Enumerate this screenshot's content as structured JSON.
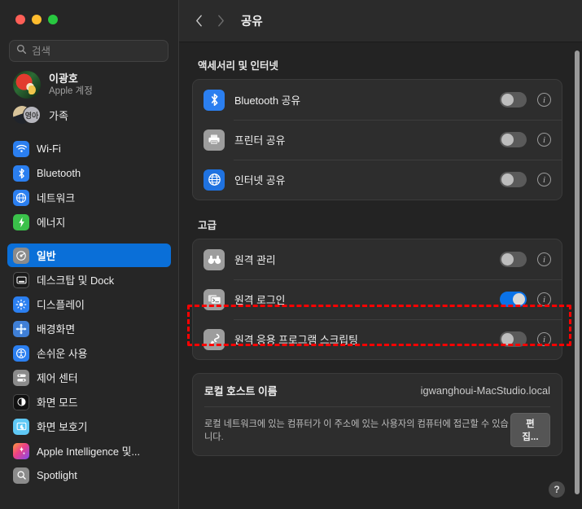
{
  "window": {
    "traffic_lights": [
      "close",
      "minimize",
      "zoom"
    ],
    "colors": {
      "accent_blue": "#0a6fd8",
      "toggle_on": "#0a72e8",
      "annotation_red": "#ff0000",
      "window_bg": "#232323",
      "sidebar_bg": "#262626",
      "card_bg": "#2d2d2d"
    }
  },
  "search": {
    "placeholder": "검색",
    "value": "",
    "icon": "search-icon"
  },
  "account": {
    "name": "이광호",
    "subtitle": "Apple 계정",
    "avatar": "parrot-photo-avatar",
    "family_label": "가족",
    "family_badge": "영아"
  },
  "sidebar": {
    "items": [
      {
        "label": "Wi-Fi",
        "icon": "wifi-icon",
        "color": "#2b7ff0",
        "selected": false,
        "group": 0
      },
      {
        "label": "Bluetooth",
        "icon": "bluetooth-icon",
        "color": "#2b7ff0",
        "selected": false,
        "group": 0
      },
      {
        "label": "네트워크",
        "icon": "network-globe-icon",
        "color": "#2b7ff0",
        "selected": false,
        "group": 0
      },
      {
        "label": "에너지",
        "icon": "energy-bolt-icon",
        "color": "#3ac14a",
        "selected": false,
        "group": 0
      },
      {
        "label": "일반",
        "icon": "general-gear-icon",
        "color": "#8b8b8b",
        "selected": true,
        "group": 1
      },
      {
        "label": "데스크탑 및 Dock",
        "icon": "desktop-dock-icon",
        "color": "#1a1a1a",
        "selected": false,
        "group": 1
      },
      {
        "label": "디스플레이",
        "icon": "display-brightness-icon",
        "color": "#2b7ff0",
        "selected": false,
        "group": 1
      },
      {
        "label": "배경화면",
        "icon": "wallpaper-icon",
        "color": "#2b7ff0",
        "selected": false,
        "group": 1
      },
      {
        "label": "손쉬운 사용",
        "icon": "accessibility-icon",
        "color": "#2b7ff0",
        "selected": false,
        "group": 1
      },
      {
        "label": "제어 센터",
        "icon": "control-center-icon",
        "color": "#8b8b8b",
        "selected": false,
        "group": 1
      },
      {
        "label": "화면 모드",
        "icon": "appearance-icon",
        "color": "#111111",
        "selected": false,
        "group": 1
      },
      {
        "label": "화면 보호기",
        "icon": "screensaver-icon",
        "color": "#5fc8f5",
        "selected": false,
        "group": 1
      },
      {
        "label": "Apple Intelligence 및...",
        "icon": "apple-intelligence-icon",
        "color": "#e0457b",
        "selected": false,
        "group": 1
      },
      {
        "label": "Spotlight",
        "icon": "spotlight-icon",
        "color": "#8b8b8b",
        "selected": false,
        "group": 1
      }
    ]
  },
  "toolbar": {
    "back_icon": "chevron-left-icon",
    "forward_icon": "chevron-right-icon",
    "title": "공유"
  },
  "main": {
    "sections": [
      {
        "heading": "액세서리 및 인터넷",
        "rows": [
          {
            "label": "Bluetooth 공유",
            "icon": "bluetooth-icon",
            "icon_color": "#2b7ff0",
            "toggle": "off",
            "info": "ⓘ"
          },
          {
            "label": "프린터 공유",
            "icon": "printer-icon",
            "icon_color": "#9d9d9d",
            "toggle": "off",
            "info": "ⓘ"
          },
          {
            "label": "인터넷 공유",
            "icon": "internet-globe-icon",
            "icon_color": "#1f72e0",
            "toggle": "off",
            "info": "ⓘ"
          }
        ]
      },
      {
        "heading": "고급",
        "rows": [
          {
            "label": "원격 관리",
            "icon": "binoculars-icon",
            "icon_color": "#9d9d9d",
            "toggle": "off",
            "info": "ⓘ"
          },
          {
            "label": "원격 로그인",
            "icon": "remote-login-terminal-icon",
            "icon_color": "#9d9d9d",
            "toggle": "on",
            "info": "ⓘ",
            "highlighted": true
          },
          {
            "label": "원격 응용 프로그램 스크립팅",
            "icon": "script-editor-icon",
            "icon_color": "#9d9d9d",
            "toggle": "off",
            "info": "ⓘ"
          }
        ]
      }
    ],
    "host": {
      "label": "로컬 호스트 이름",
      "value": "igwanghoui-MacStudio.local",
      "note": "로컬 네트워크에 있는 컴퓨터가 이 주소에 있는 사용자의 컴퓨터에 접근할 수 있습니다.",
      "edit_button": "편집..."
    },
    "help_button": "?"
  }
}
